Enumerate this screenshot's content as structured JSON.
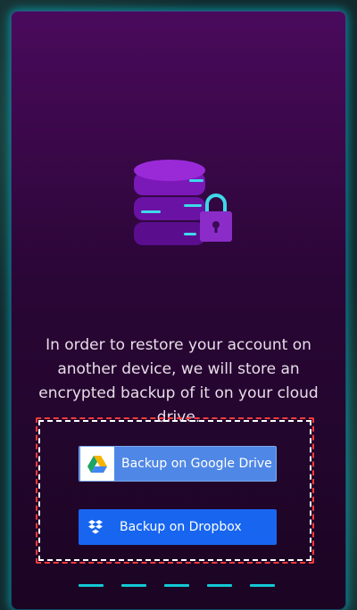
{
  "restore_screen": {
    "illustration_icon": "database-lock-icon",
    "message": "In order to restore your account on another device, we will store an encrypted backup of it on your cloud drive.",
    "buttons": {
      "google_drive_label": "Backup on Google Drive",
      "google_drive_icon": "google-drive-icon",
      "dropbox_label": "Backup on Dropbox",
      "dropbox_icon": "dropbox-icon"
    },
    "pager": {
      "pages": 5
    }
  },
  "colors": {
    "panel_top": "#4a0a5c",
    "panel_bottom": "#1b0523",
    "accent_glow": "#00d2e6",
    "google_button": "#4f87e6",
    "dropbox_button": "#1866f0",
    "highlight_border": "#ff3b3b"
  }
}
